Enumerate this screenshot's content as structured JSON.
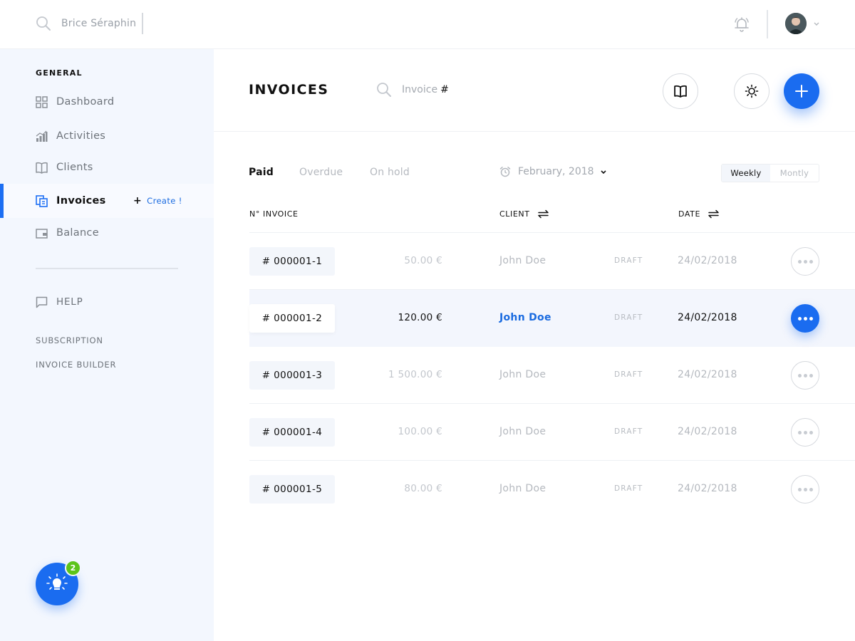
{
  "topbar": {
    "search_value": "Brice Séraphin",
    "search_icon": "search-icon",
    "notification_icon": "bell-icon",
    "avatar_icon": "user-avatar",
    "avatar_menu_icon": "chevron-down-icon"
  },
  "sidebar": {
    "heading": "GENERAL",
    "items": [
      {
        "label": "Dashboard",
        "icon": "grid-icon",
        "active": false
      },
      {
        "label": "Activities",
        "icon": "bar-chart-icon",
        "active": false
      },
      {
        "label": "Clients",
        "icon": "book-icon",
        "active": false
      },
      {
        "label": "Invoices",
        "icon": "invoice-icon",
        "active": true
      },
      {
        "label": "Balance",
        "icon": "wallet-icon",
        "active": false
      }
    ],
    "create_label": "Create !",
    "help_label": "HELP",
    "links": [
      "SUBSCRIPTION",
      "INVOICE BUILDER"
    ],
    "notification_count": "2",
    "fab_icon": "lightbulb-icon"
  },
  "header": {
    "title": "INVOICES",
    "search_placeholder": "Invoice",
    "search_hash": "#",
    "actions": [
      "book-icon",
      "sun-icon",
      "plus-icon"
    ]
  },
  "filters": {
    "tabs": [
      "Paid",
      "Overdue",
      "On hold"
    ],
    "active_tab": "Paid",
    "date_label": "February, 2018",
    "view_options": [
      "Weekly",
      "Montly"
    ],
    "active_view": "Weekly"
  },
  "table": {
    "columns": {
      "invoice": "N° INVOICE",
      "client": "CLIENT",
      "date": "DATE"
    },
    "rows": [
      {
        "number": "# 000001-1",
        "amount": "50.00 €",
        "client": "John Doe",
        "status": "DRAFT",
        "date": "24/02/2018",
        "selected": false
      },
      {
        "number": "# 000001-2",
        "amount": "120.00 €",
        "client": "John Doe",
        "status": "DRAFT",
        "date": "24/02/2018",
        "selected": true
      },
      {
        "number": "# 000001-3",
        "amount": "1 500.00 €",
        "client": "John Doe",
        "status": "DRAFT",
        "date": "24/02/2018",
        "selected": false
      },
      {
        "number": "# 000001-4",
        "amount": "100.00 €",
        "client": "John Doe",
        "status": "DRAFT",
        "date": "24/02/2018",
        "selected": false
      },
      {
        "number": "# 000001-5",
        "amount": "80.00 €",
        "client": "John Doe",
        "status": "DRAFT",
        "date": "24/02/2018",
        "selected": false
      }
    ]
  },
  "colors": {
    "accent": "#1a6cf0",
    "sidebar_bg": "#f3f7fe",
    "badge": "#5cc41a"
  }
}
